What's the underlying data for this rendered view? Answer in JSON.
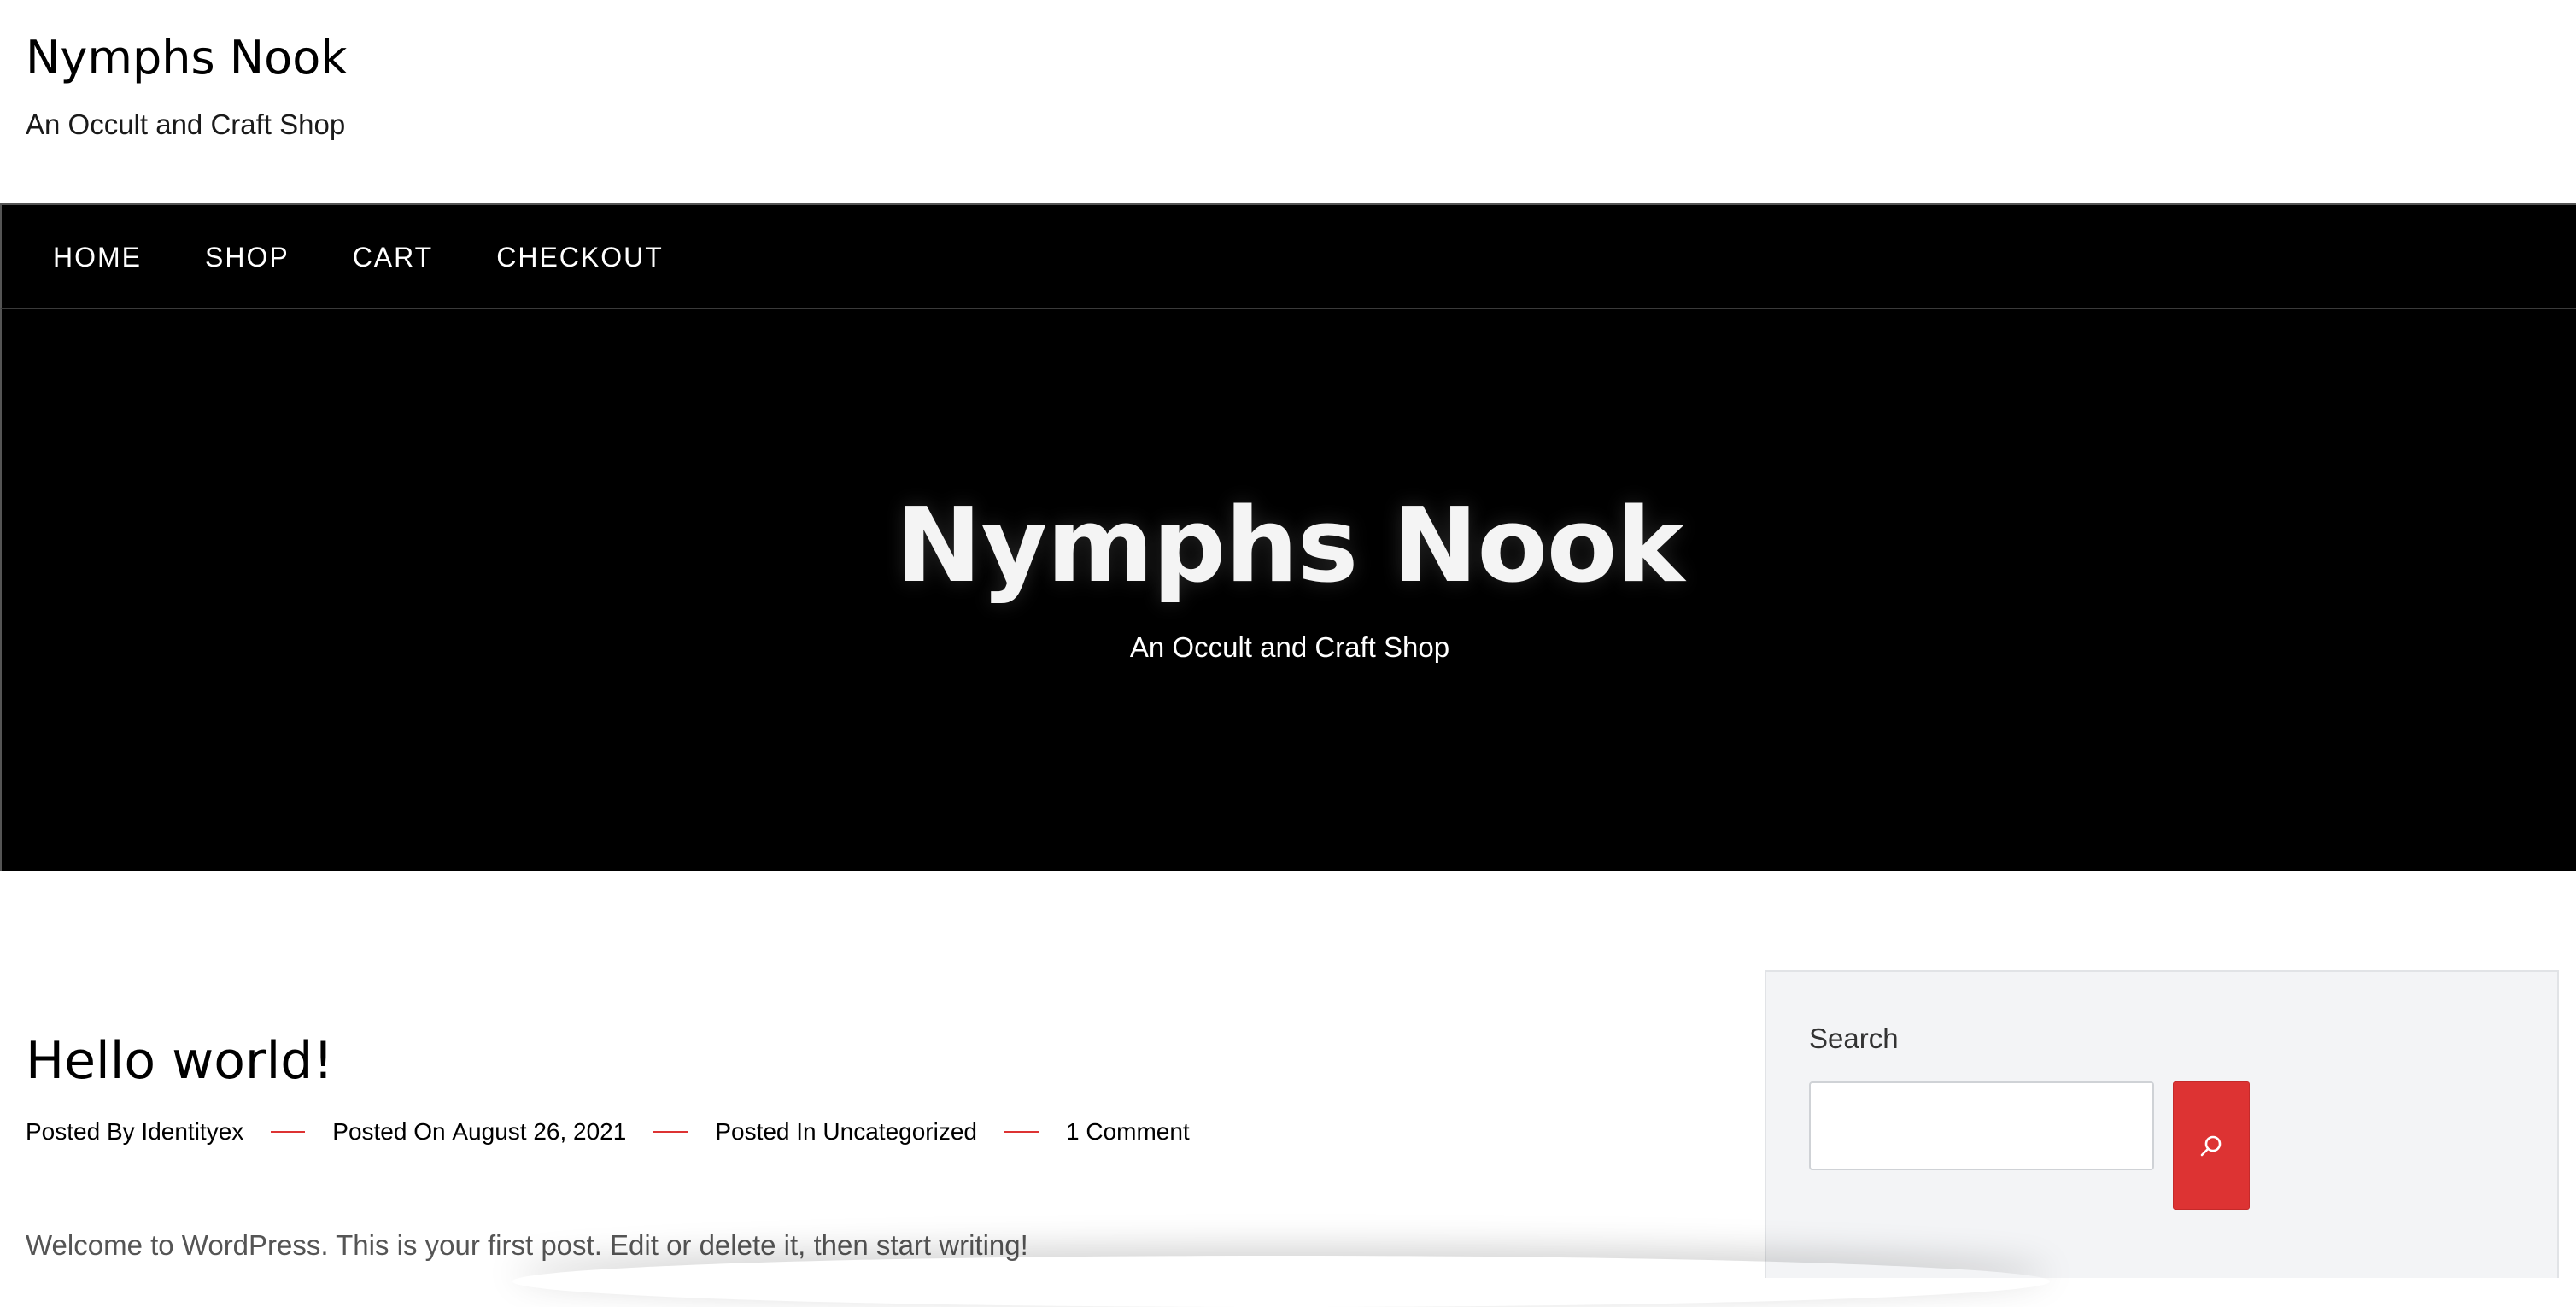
{
  "header": {
    "site_title": "Nymphs Nook",
    "tagline": "An Occult and Craft Shop"
  },
  "nav": {
    "items": [
      {
        "label": "HOME"
      },
      {
        "label": "SHOP"
      },
      {
        "label": "CART"
      },
      {
        "label": "CHECKOUT"
      }
    ]
  },
  "hero": {
    "title": "Nymphs Nook",
    "tagline": "An Occult and Craft Shop"
  },
  "post": {
    "title": "Hello world!",
    "meta": {
      "author_prefix": "Posted By",
      "author": "Identityex",
      "date_prefix": "Posted On",
      "date": "August 26, 2021",
      "category_prefix": "Posted In",
      "category": "Uncategorized",
      "comments": "1 Comment"
    },
    "excerpt": "Welcome to WordPress. This is your first post. Edit or delete it, then start writing!"
  },
  "sidebar": {
    "search": {
      "label": "Search",
      "value": "",
      "placeholder": "",
      "button_icon": "search-icon"
    }
  },
  "colors": {
    "accent": "#dd3333",
    "nav_bg": "#000000",
    "sidebar_bg": "#f3f4f6"
  }
}
